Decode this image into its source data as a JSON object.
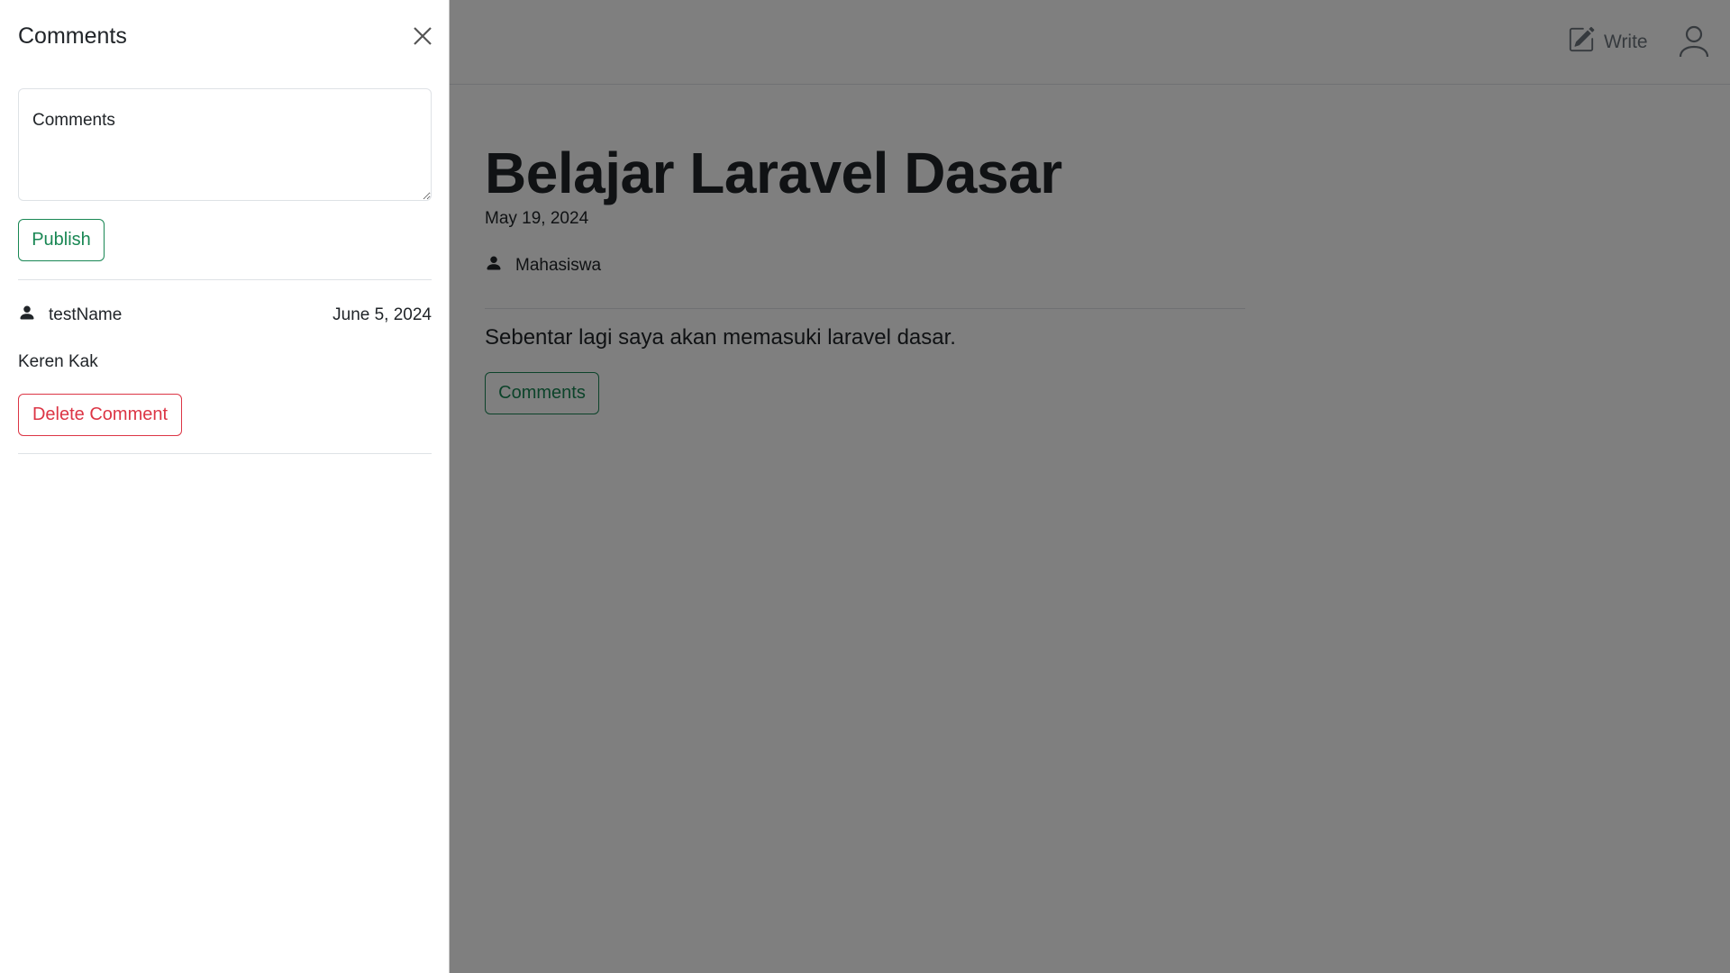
{
  "nav": {
    "write_label": "Write",
    "write_icon": "pencil-square-icon",
    "user_icon": "person-icon"
  },
  "post": {
    "title": "Belajar Laravel Dasar",
    "date": "May 19, 2024",
    "author": "Mahasiswa",
    "body": "Sebentar lagi saya akan memasuki laravel dasar.",
    "comments_button": "Comments"
  },
  "offcanvas": {
    "title": "Comments",
    "textarea_placeholder": "Comments",
    "publish_button": "Publish",
    "comments": [
      {
        "author": "testName",
        "date": "June 5, 2024",
        "text": "Keren Kak",
        "delete_button": "Delete Comment"
      }
    ]
  },
  "colors": {
    "success": "#198754",
    "danger": "#dc3545",
    "backdrop": "rgba(0,0,0,0.5)",
    "border": "#dee2e6"
  }
}
